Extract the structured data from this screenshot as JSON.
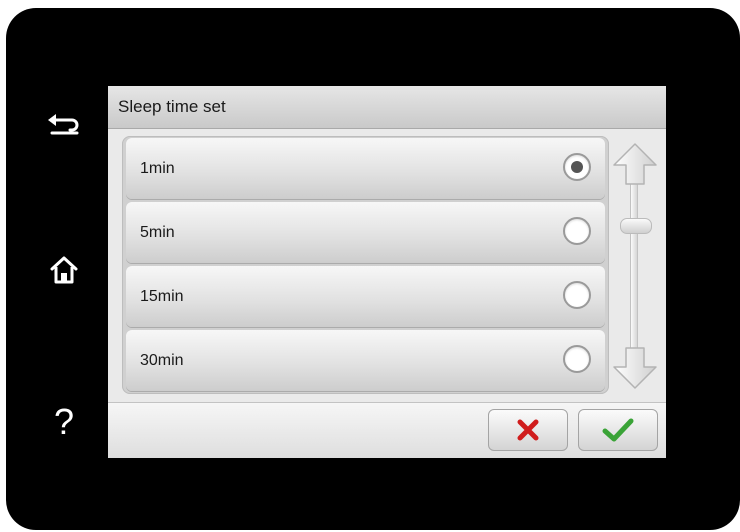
{
  "window": {
    "title": "Sleep time set"
  },
  "side_buttons": [
    {
      "icon": "back-arrow-icon"
    },
    {
      "icon": "home-icon"
    },
    {
      "icon": "help-icon",
      "glyph": "?"
    }
  ],
  "options": [
    {
      "label": "1min",
      "selected": true
    },
    {
      "label": "5min",
      "selected": false
    },
    {
      "label": "15min",
      "selected": false
    },
    {
      "label": "30min",
      "selected": false
    }
  ],
  "scrollbar": {
    "up_icon": "arrow-up-icon",
    "down_icon": "arrow-down-icon"
  },
  "actions": {
    "cancel_icon": "x-icon",
    "confirm_icon": "checkmark-icon"
  },
  "colors": {
    "bezel": "#000000",
    "cancel": "#d01c1c",
    "confirm": "#3aa337"
  }
}
